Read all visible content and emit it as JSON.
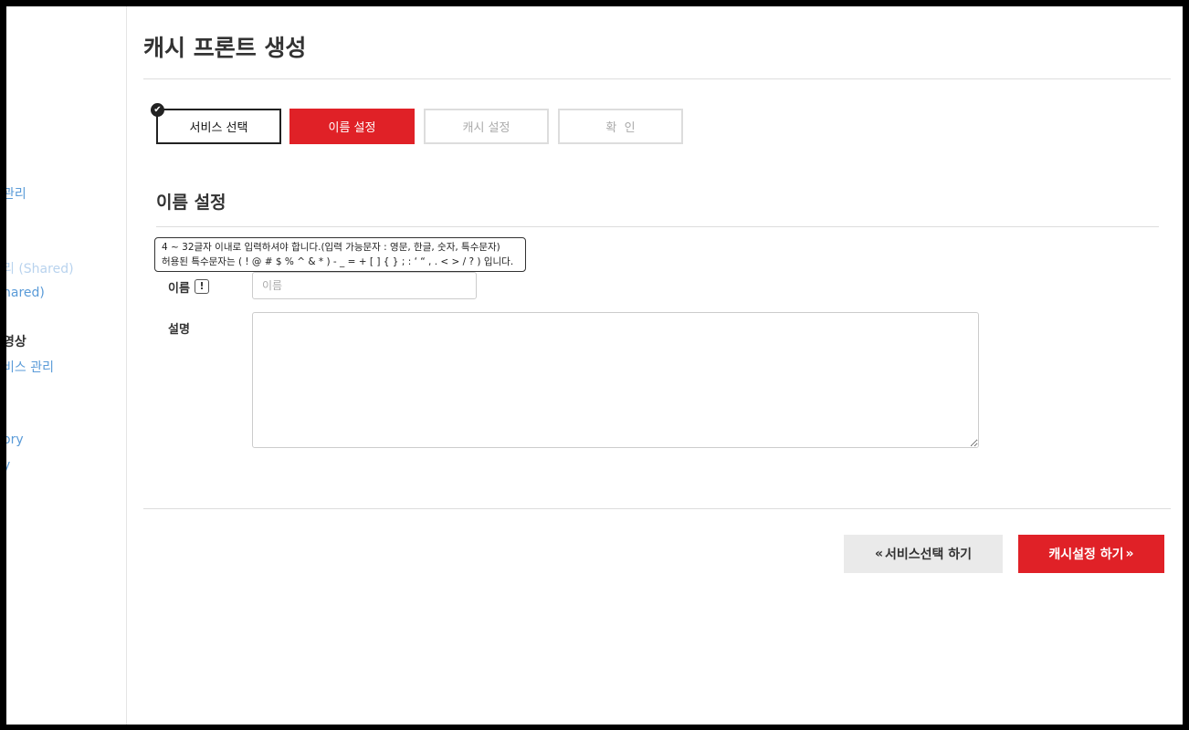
{
  "sidebar": {
    "items": [
      {
        "label": "관리",
        "style": "link"
      },
      {
        "label": "리 (Shared)",
        "style": "link"
      },
      {
        "label": "hared)",
        "style": "link"
      },
      {
        "label": "영상",
        "style": "heading"
      },
      {
        "label": "비스 관리",
        "style": "link"
      },
      {
        "label": "ory",
        "style": "link"
      },
      {
        "label": "y",
        "style": "link"
      }
    ]
  },
  "page": {
    "title": "캐시 프론트 생성"
  },
  "steps": [
    {
      "label": "서비스 선택",
      "state": "done"
    },
    {
      "label": "이름 설정",
      "state": "active"
    },
    {
      "label": "캐시 설정",
      "state": "todo"
    },
    {
      "label": "확  인",
      "state": "todo"
    }
  ],
  "section": {
    "title": "이름 설정"
  },
  "form": {
    "name_label": "이름",
    "name_placeholder": "이름",
    "name_value": "",
    "info_icon": "!",
    "desc_label": "설명",
    "desc_value": ""
  },
  "tooltip": {
    "line1": "4 ~ 32글자 이내로 입력하셔야 합니다.(입력 가능문자 : 영문, 한글, 숫자, 특수문자)",
    "line2": "허용된 특수문자는 ( ! @ # $ % ^ & *  ) - _ = + [ ] { } ; : ‘ “ , . < > / ? ) 입니다."
  },
  "buttons": {
    "back": {
      "icon": "«",
      "label": "서비스선택 하기"
    },
    "next": {
      "label": "캐시설정 하기",
      "icon": "»"
    }
  },
  "colors": {
    "accent": "#e02127",
    "link": "#5a9bd8",
    "step_done_border": "#222222",
    "step_todo_border": "#dddddd",
    "back_button_bg": "#eaeaea"
  },
  "icons": {
    "done_step": "check-circle-icon",
    "name_info": "exclamation-icon",
    "back_button": "double-chevron-left-icon",
    "next_button": "double-chevron-right-icon"
  }
}
